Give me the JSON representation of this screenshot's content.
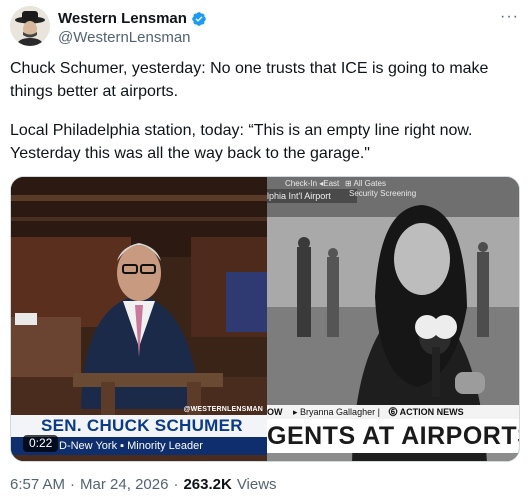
{
  "author": {
    "display_name": "Western Lensman",
    "handle": "@WesternLensman",
    "verified": true,
    "avatar_icon": "cowboy-avatar-icon"
  },
  "more_icon": "ellipsis-icon",
  "tweet": {
    "paragraph_1": "Chuck Schumer, yesterday: No one trusts that ICE is going to make things better at airports.",
    "paragraph_2": "Local Philadelphia station, today: “This is an empty line right now. Yesterday this was all the way back to the garage.\""
  },
  "media": {
    "left": {
      "watermark": "@WESTERNLENSMAN",
      "lower_third_name": "SEN. CHUCK SCHUMER",
      "lower_third_sub": "D-New York  ▪  Minority Leader",
      "timer": "0:22"
    },
    "right": {
      "sign_1": "Check-In ◂East",
      "sign_2": "⊞ All Gates",
      "sign_3": "Security Screening",
      "sign_airport": "lphia Int'l Airport",
      "bar_ow": "OW",
      "bar_reporter": "▸ Bryanna Gallagher |",
      "bar_network": "⓺ ACTION NEWS",
      "headline": "GENTS AT AIRPORTS"
    }
  },
  "meta": {
    "time": "6:57 AM",
    "sep1": "·",
    "date": "Mar 24, 2026",
    "sep2": "·",
    "views_count": "263.2K",
    "views_label": "Views"
  },
  "colors": {
    "verified_blue": "#1d9bf0",
    "lower_third_navy": "#0e2e6e",
    "lower_third_text": "#0b3a86",
    "muted_text": "#536471"
  }
}
